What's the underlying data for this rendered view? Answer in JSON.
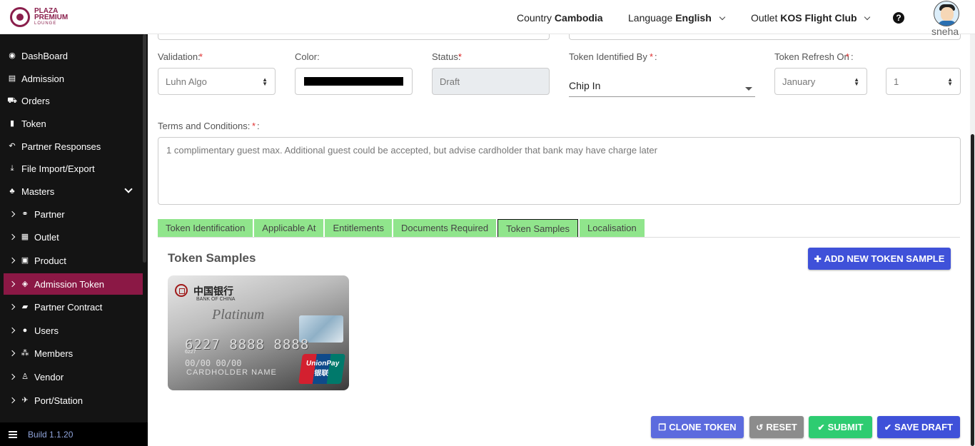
{
  "header": {
    "logo_line1": "PLAZA",
    "logo_line2": "PREMIUM",
    "logo_line3": "LOUNGE",
    "country_label": "Country",
    "country_value": "Cambodia",
    "language_label": "Language",
    "language_value": "English",
    "outlet_label": "Outlet",
    "outlet_value": "KOS Flight Club",
    "help_icon": "?",
    "username": "sneha"
  },
  "sidebar": {
    "items": [
      {
        "label": "DashBoard",
        "icon": "dashboard-icon"
      },
      {
        "label": "Admission",
        "icon": "id-card-icon"
      },
      {
        "label": "Orders",
        "icon": "cart-icon"
      },
      {
        "label": "Token",
        "icon": "file-icon"
      },
      {
        "label": "Partner Responses",
        "icon": "reply-icon"
      },
      {
        "label": "File Import/Export",
        "icon": "download-icon"
      },
      {
        "label": "Masters",
        "icon": "sitemap-icon"
      },
      {
        "label": "Partner",
        "icon": "handshake-icon"
      },
      {
        "label": "Outlet",
        "icon": "building-icon"
      },
      {
        "label": "Product",
        "icon": "gift-icon"
      },
      {
        "label": "Admission Token",
        "icon": "tags-icon"
      },
      {
        "label": "Partner Contract",
        "icon": "briefcase-icon"
      },
      {
        "label": "Users",
        "icon": "user-icon"
      },
      {
        "label": "Members",
        "icon": "users-icon"
      },
      {
        "label": "Vendor",
        "icon": "person-icon"
      },
      {
        "label": "Port/Station",
        "icon": "plane-icon"
      }
    ],
    "build": "Build 1.1.20"
  },
  "form": {
    "validation_label": "Validation:",
    "validation_value": "Luhn Algo",
    "color_label": "Color:",
    "color_value": "#000000",
    "status_label": "Status:",
    "status_value": "Draft",
    "token_identified_label": "Token Identified By",
    "token_identified_value": "Chip In",
    "token_refresh_label": "Token Refresh On",
    "token_refresh_month": "January",
    "token_refresh_day": "1",
    "terms_label": "Terms and Conditions:",
    "terms_value": "1 complimentary guest max. Additional guest could be accepted, but advise cardholder that bank may have charge later",
    "required_mark": "*"
  },
  "tabs": [
    "Token Identification",
    "Applicable At",
    "Entitlements",
    "Documents Required",
    "Token Samples",
    "Localisation"
  ],
  "samples": {
    "title": "Token Samples",
    "add_button": "ADD NEW TOKEN SAMPLE",
    "card": {
      "bank_cn": "中国银行",
      "bank_en": "BANK OF CHINA",
      "tier": "Platinum",
      "number": "6227 8888 8888",
      "small_number": "6227",
      "expiry": "00/00   00/00",
      "holder": "CARDHOLDER NAME",
      "brand": "UnionPay",
      "brand_cn": "银联"
    }
  },
  "actions": {
    "clone": "CLONE TOKEN",
    "reset": "RESET",
    "submit": "SUBMIT",
    "save_draft": "SAVE DRAFT"
  },
  "colors": {
    "brand": "#8b1845",
    "tab_bg": "#90e58c",
    "primary_btn": "#3f51d9",
    "clone_btn": "#5c6bde",
    "reset_btn": "#8c8c8c",
    "submit_btn": "#2ecc71"
  }
}
